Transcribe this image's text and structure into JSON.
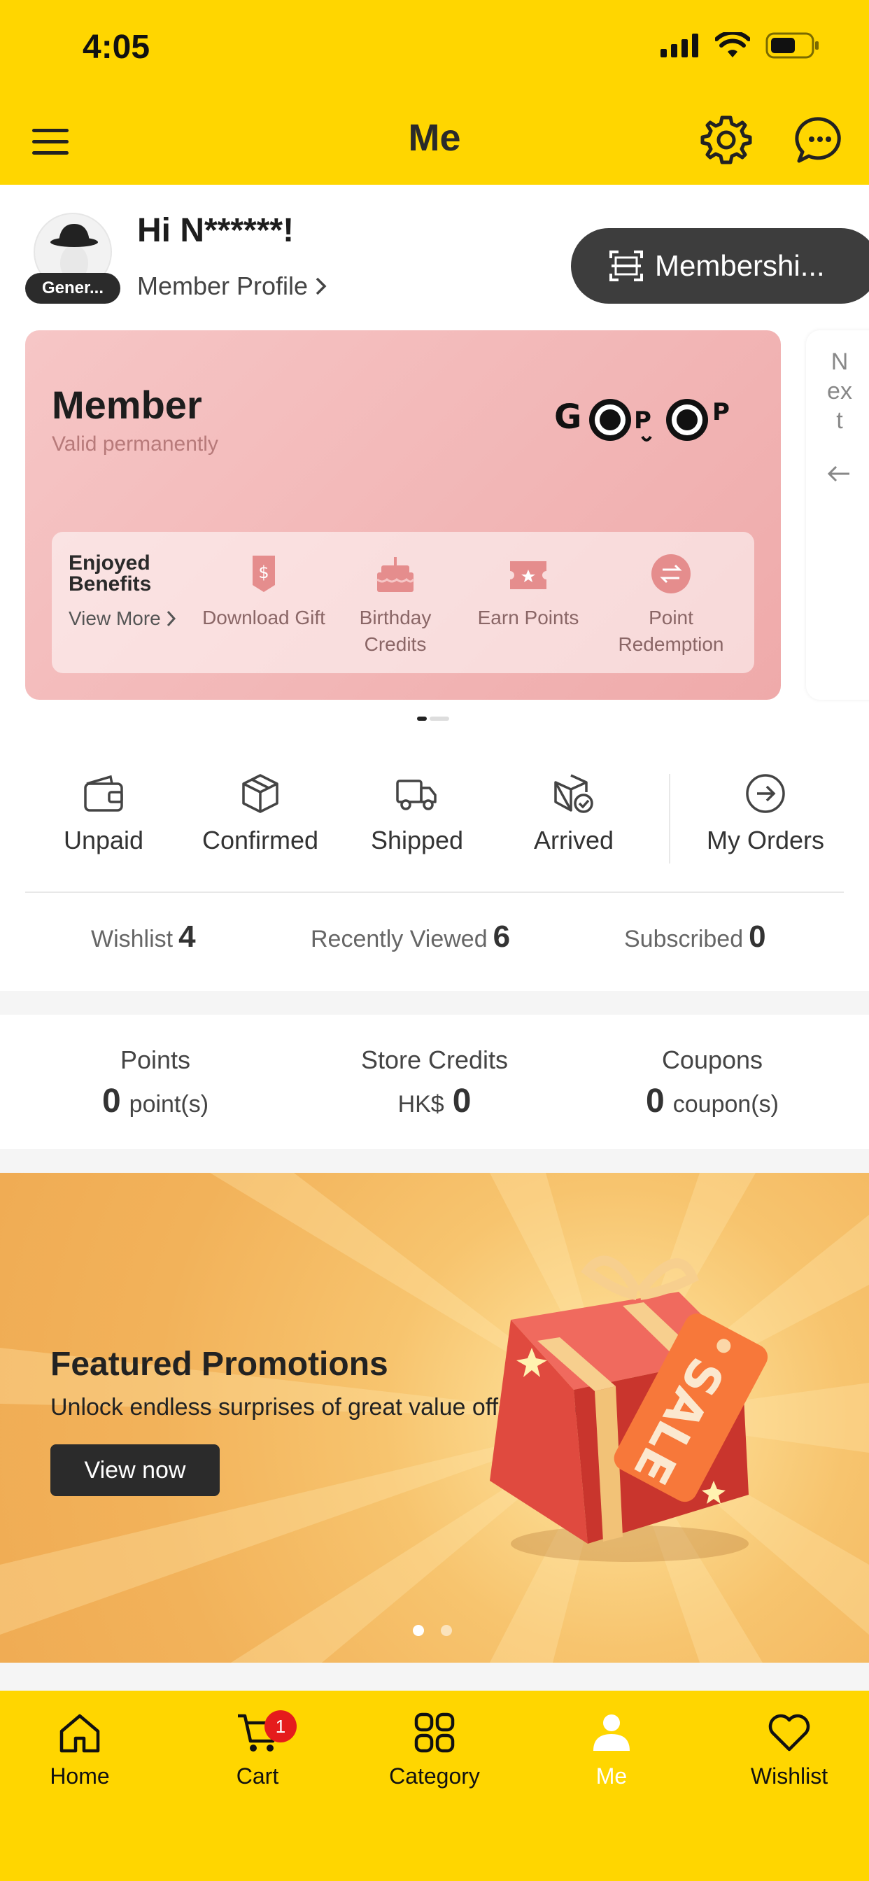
{
  "status_bar": {
    "time": "4:05"
  },
  "header": {
    "title": "Me"
  },
  "profile": {
    "greeting": "Hi N******!",
    "badge": "Gener...",
    "profile_link": "Member Profile",
    "membership_button": "Membershi..."
  },
  "member_card": {
    "title": "Member",
    "validity": "Valid permanently",
    "benefits_title": "Enjoyed Benefits",
    "view_more": "View More",
    "benefits": [
      {
        "label": "Download Gift",
        "icon": "download-gift-icon"
      },
      {
        "label": "Birthday Credits",
        "icon": "birthday-cake-icon"
      },
      {
        "label": "Earn Points",
        "icon": "earn-points-icon"
      },
      {
        "label": "Point Redemption",
        "icon": "point-redemption-icon"
      }
    ],
    "next_label": "Next",
    "accent_color": "#efaaaa"
  },
  "orders": {
    "items": [
      {
        "label": "Unpaid",
        "icon": "wallet-icon"
      },
      {
        "label": "Confirmed",
        "icon": "box-icon"
      },
      {
        "label": "Shipped",
        "icon": "truck-icon"
      },
      {
        "label": "Arrived",
        "icon": "box-check-icon"
      },
      {
        "label": "My Orders",
        "icon": "arrow-circle-icon"
      }
    ]
  },
  "stats": [
    {
      "label": "Wishlist",
      "value": "4"
    },
    {
      "label": "Recently Viewed",
      "value": "6"
    },
    {
      "label": "Subscribed",
      "value": "0"
    }
  ],
  "wallet": {
    "points": {
      "label": "Points",
      "value": "0",
      "unit": "point(s)"
    },
    "credits": {
      "label": "Store Credits",
      "currency": "HK$",
      "value": "0"
    },
    "coupons": {
      "label": "Coupons",
      "value": "0",
      "unit": "coupon(s)"
    }
  },
  "promo": {
    "title": "Featured Promotions",
    "subtitle": "Unlock endless surprises of great value offers now!",
    "button": "View now",
    "tag_text": "SALE"
  },
  "tabbar": {
    "tabs": [
      {
        "label": "Home",
        "icon": "home-icon"
      },
      {
        "label": "Cart",
        "icon": "cart-icon",
        "badge": "1"
      },
      {
        "label": "Category",
        "icon": "category-icon"
      },
      {
        "label": "Me",
        "icon": "person-icon",
        "active": true
      },
      {
        "label": "Wishlist",
        "icon": "heart-icon"
      }
    ],
    "color": "#FFD600"
  }
}
